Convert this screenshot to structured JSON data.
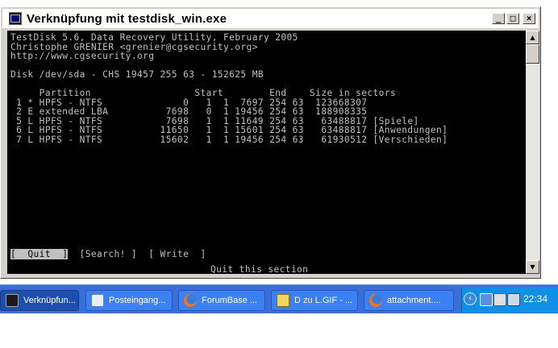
{
  "window": {
    "title": "Verknüpfung mit testdisk_win.exe",
    "buttons": {
      "minimize": "_",
      "maximize": "□",
      "close": "×"
    }
  },
  "console": {
    "header_lines": [
      "TestDisk 5.6, Data Recovery Utility, February 2005",
      "Christophe GRENIER <grenier@cgsecurity.org>",
      "http://www.cgsecurity.org",
      "",
      "Disk /dev/sda - CHS 19457 255 63 - 152625 MB"
    ],
    "table_header": "     Partition                  Start        End    Size in sectors",
    "partitions": [
      " 1 * HPFS - NTFS              0   1  1  7697 254 63  123668307",
      " 2 E extended LBA          7698   0  1 19456 254 63  188908335",
      " 5 L HPFS - NTFS           7698   1  1 11649 254 63   63488817 [Spiele]",
      " 6 L HPFS - NTFS          11650   1  1 15601 254 63   63488817 [Anwendungen]",
      " 7 L HPFS - NTFS          15602   1  1 19456 254 63   61930512 [Verschieden]"
    ],
    "menu": {
      "quit": "[  Quit  ]",
      "search": "[Search! ]",
      "write": "[ Write  ]"
    },
    "status": "Quit this section"
  },
  "taskbar": {
    "tasks": [
      {
        "label": "Verknüpfun...",
        "icon": "console-icon",
        "active": true
      },
      {
        "label": "Posteingang...",
        "icon": "mail-icon",
        "active": false
      },
      {
        "label": "ForumBase ...",
        "icon": "firefox-icon",
        "active": false
      },
      {
        "label": "D zu L.GIF - ...",
        "icon": "image-viewer-icon",
        "active": false
      },
      {
        "label": "attachment....",
        "icon": "firefox-icon",
        "active": false
      }
    ],
    "tray": {
      "expand": "‹",
      "icons": [
        "network-icon",
        "printer-icon",
        "volume-icon"
      ],
      "clock": "22:34"
    }
  }
}
